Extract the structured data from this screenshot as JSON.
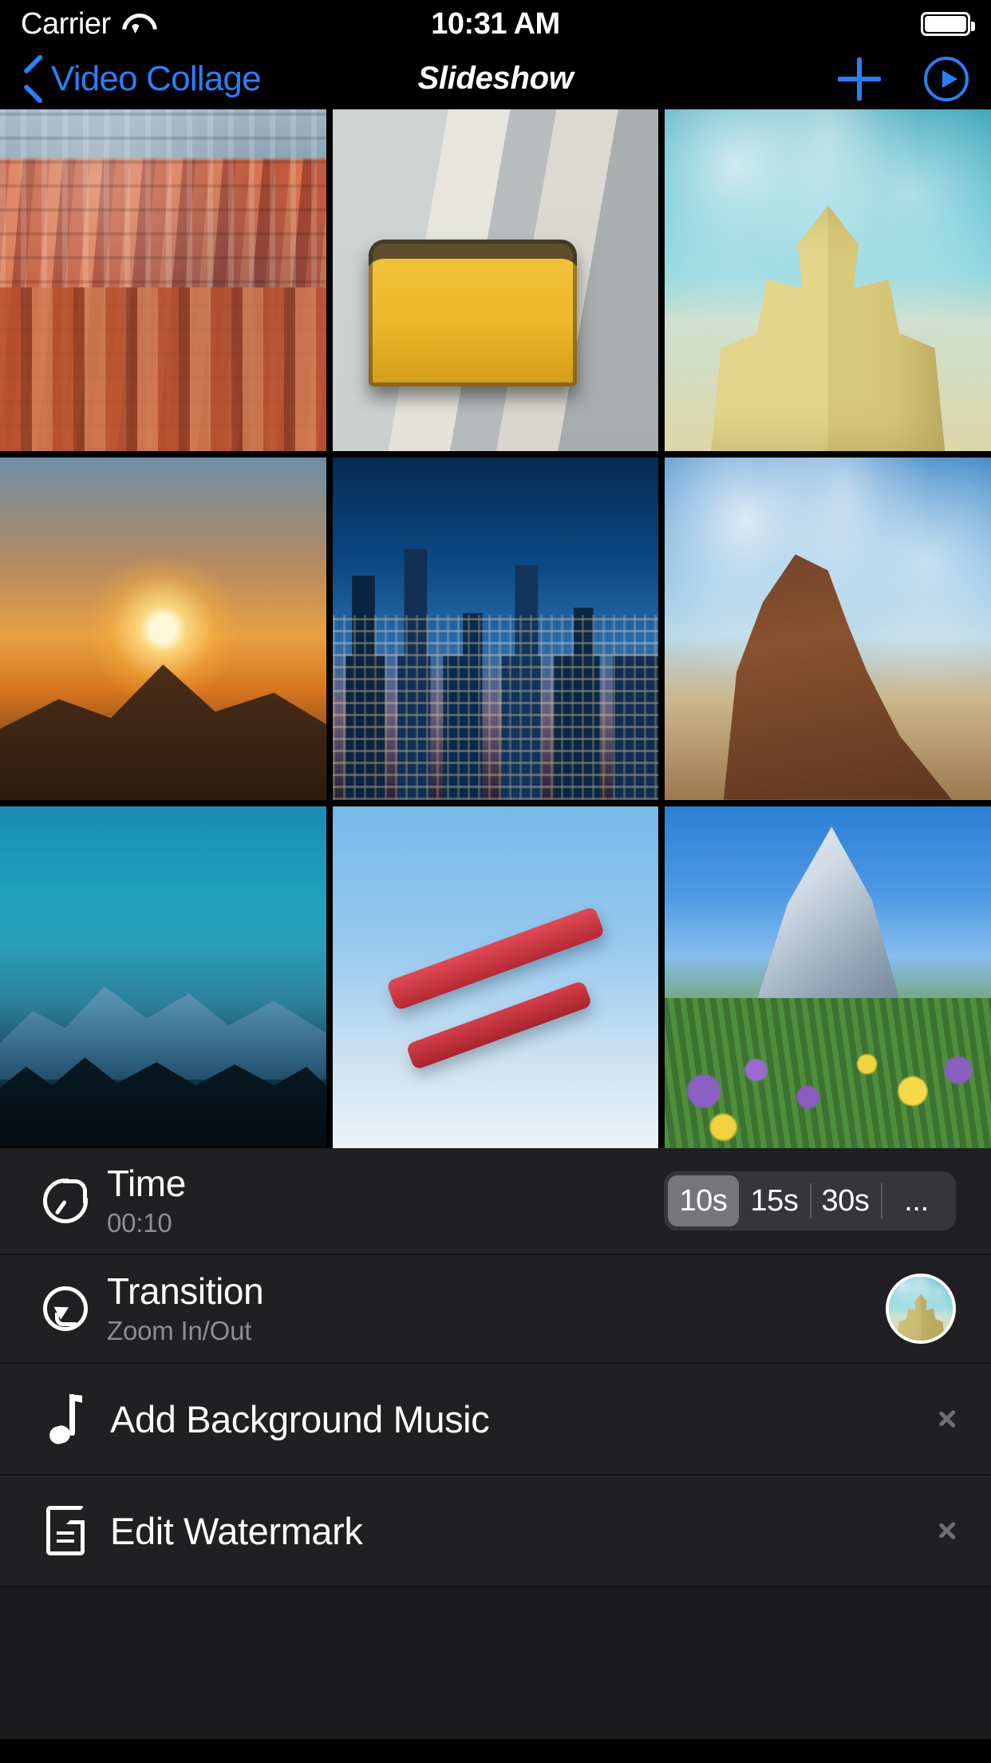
{
  "status_bar": {
    "carrier": "Carrier",
    "wifi_icon": "wifi-icon",
    "time": "10:31 AM",
    "battery_icon": "battery-full-icon"
  },
  "nav_bar": {
    "back_icon": "chevron-left-icon",
    "back_label": "Video Collage",
    "title": "Slideshow",
    "add_icon": "plus-icon",
    "play_icon": "play-circle-icon",
    "accent_color": "#2c7ef8"
  },
  "photo_grid": {
    "columns": 3,
    "rows": 3,
    "items": [
      {
        "name": "city-rooftops-photo",
        "art": "art-city"
      },
      {
        "name": "tram-street-photo",
        "art": "art-tram"
      },
      {
        "name": "sand-castle-photo",
        "art": "art-sand"
      },
      {
        "name": "sunrise-mountain-photo",
        "art": "art-sunrise"
      },
      {
        "name": "night-skyline-photo",
        "art": "art-skyline"
      },
      {
        "name": "desert-butte-photo",
        "art": "art-butte"
      },
      {
        "name": "misty-mountains-photo",
        "art": "art-mountains"
      },
      {
        "name": "biplane-sky-photo",
        "art": "art-plane"
      },
      {
        "name": "matterhorn-flowers-photo",
        "art": "art-matterhorn"
      }
    ]
  },
  "settings": {
    "time_row": {
      "icon": "timer-icon",
      "title": "Time",
      "subtitle": "00:10",
      "options": [
        "10s",
        "15s",
        "30s",
        "..."
      ],
      "selected": "10s"
    },
    "transition_row": {
      "icon": "transition-arrow-icon",
      "title": "Transition",
      "subtitle": "Zoom In/Out",
      "thumbnail": "sand-castle-thumbnail"
    },
    "music_row": {
      "icon": "music-note-icon",
      "label": "Add Background Music",
      "chevron": "chevron-right-icon"
    },
    "watermark_row": {
      "icon": "document-icon",
      "label": "Edit Watermark",
      "chevron": "chevron-right-icon"
    }
  },
  "colors": {
    "accent": "#2c7ef8",
    "panel_bg": "#202022",
    "screen_bg": "#1b1b1d",
    "segment_bg": "#36363a",
    "segment_active": "#75757a",
    "subtitle": "#8d8d92"
  }
}
